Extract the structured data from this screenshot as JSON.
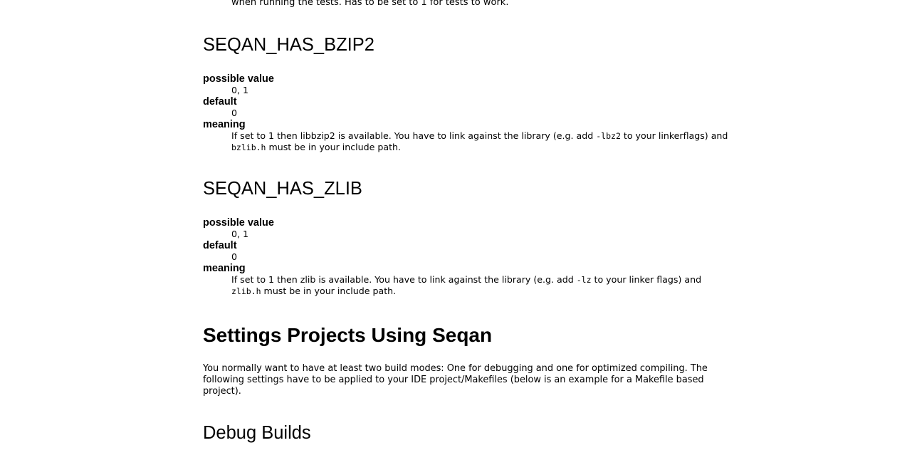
{
  "top_fragment": "when running the tests. Has to be set to 1 for tests to work.",
  "bzip2": {
    "heading": "SEQAN_HAS_BZIP2",
    "possible_label": "possible value",
    "possible_value": "0, 1",
    "default_label": "default",
    "default_value": "0",
    "meaning_label": "meaning",
    "meaning_1": "If set to 1 then libbzip2 is available. You have to link against the library (e.g. add ",
    "meaning_code_1": "-lbz2",
    "meaning_2": " to your linkerflags) and ",
    "meaning_code_2": "bzlib.h",
    "meaning_3": " must be in your include path."
  },
  "zlib": {
    "heading": "SEQAN_HAS_ZLIB",
    "possible_label": "possible value",
    "possible_value": "0, 1",
    "default_label": "default",
    "default_value": "0",
    "meaning_label": "meaning",
    "meaning_1": "If set to 1 then zlib is available. You have to link against the library (e.g. add ",
    "meaning_code_1": "-lz",
    "meaning_2": " to your linker flags) and ",
    "meaning_code_2": "zlib.h",
    "meaning_3": " must be in your include path."
  },
  "settings": {
    "heading": "Settings Projects Using Seqan",
    "paragraph": "You normally want to have at least two build modes: One for debugging and one for optimized compiling. The following settings have to be applied to your IDE project/Makefiles (below is an example for a Makefile based project)."
  },
  "debug": {
    "heading": "Debug Builds"
  }
}
